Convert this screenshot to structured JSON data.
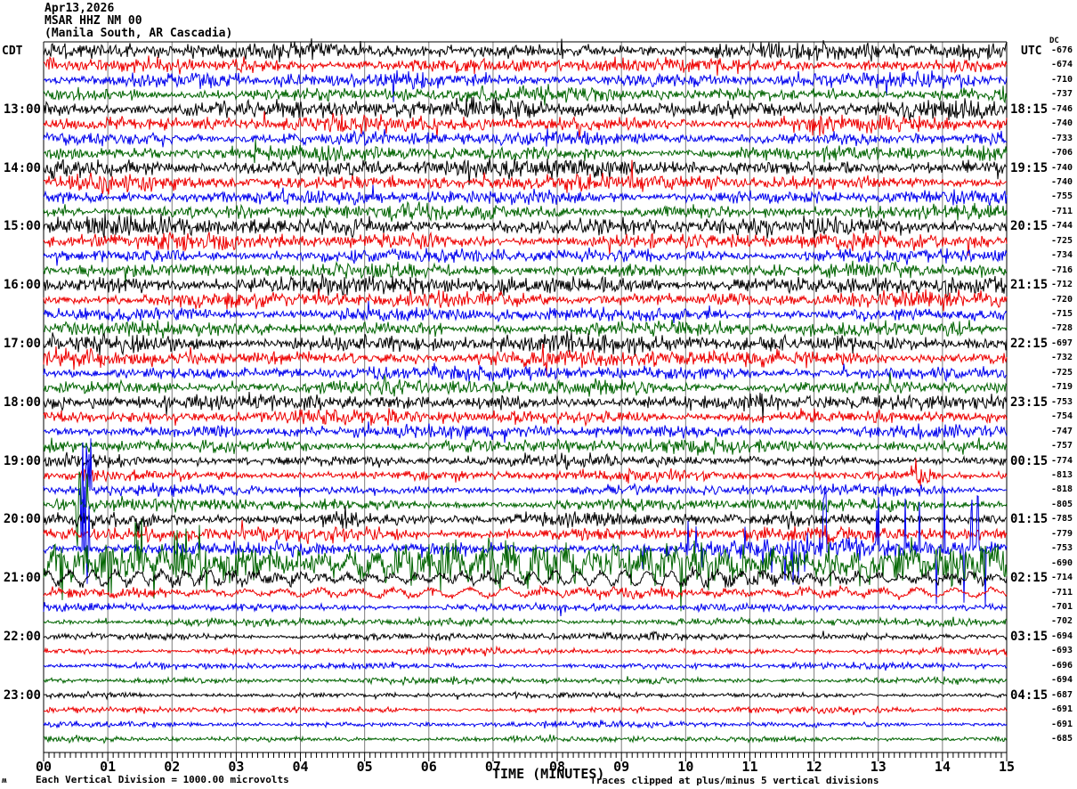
{
  "header": {
    "date": "Apr13,2026",
    "station_id": "MSAR HHZ NM 00",
    "station_name": "(Manila South, AR Cascadia)"
  },
  "timezones": {
    "left": "CDT",
    "right": "UTC"
  },
  "right_column_header": "DC",
  "x_axis": {
    "title": "TIME (MINUTES)",
    "tick_labels": [
      "00",
      "01",
      "02",
      "03",
      "04",
      "05",
      "06",
      "07",
      "08",
      "09",
      "10",
      "11",
      "12",
      "13",
      "14",
      "15"
    ]
  },
  "footer": {
    "scale_note": "Each Vertical Division = 1000.00 microvolts",
    "clip_note": "Traces clipped at plus/minus 5 vertical divisions",
    "corner_mark": "ʍ"
  },
  "left_hour_labels": [
    {
      "row": 4,
      "label": "13:00"
    },
    {
      "row": 8,
      "label": "14:00"
    },
    {
      "row": 12,
      "label": "15:00"
    },
    {
      "row": 16,
      "label": "16:00"
    },
    {
      "row": 20,
      "label": "17:00"
    },
    {
      "row": 24,
      "label": "18:00"
    },
    {
      "row": 28,
      "label": "19:00"
    },
    {
      "row": 32,
      "label": "20:00"
    },
    {
      "row": 36,
      "label": "21:00"
    },
    {
      "row": 40,
      "label": "22:00"
    },
    {
      "row": 44,
      "label": "23:00"
    }
  ],
  "right_utc_labels": [
    {
      "row": 4,
      "label": "18:15"
    },
    {
      "row": 8,
      "label": "19:15"
    },
    {
      "row": 12,
      "label": "20:15"
    },
    {
      "row": 16,
      "label": "21:15"
    },
    {
      "row": 20,
      "label": "22:15"
    },
    {
      "row": 24,
      "label": "23:15"
    },
    {
      "row": 28,
      "label": "00:15"
    },
    {
      "row": 32,
      "label": "01:15"
    },
    {
      "row": 36,
      "label": "02:15"
    },
    {
      "row": 40,
      "label": "03:15"
    },
    {
      "row": 44,
      "label": "04:15"
    }
  ],
  "colors": {
    "trace_cycle": [
      "#000000",
      "#ee0000",
      "#0000ee",
      "#006400"
    ],
    "grid": "#7d7d7d",
    "axis": "#000000",
    "background": "#ffffff"
  },
  "chart_data": {
    "type": "line",
    "subtype": "seismogram-helicorder",
    "rows": 48,
    "minutes_per_row": 15,
    "x_range_minutes": [
      0,
      15
    ],
    "clip_divisions": 5,
    "microvolts_per_division": 1000.0,
    "row_color_cycle": [
      "black",
      "red",
      "blue",
      "green"
    ],
    "dc_offsets": [
      -676,
      -674,
      -710,
      -737,
      -746,
      -740,
      -733,
      -706,
      -740,
      -740,
      -755,
      -711,
      -744,
      -725,
      -734,
      -716,
      -712,
      -720,
      -715,
      -728,
      -697,
      -732,
      -725,
      -719,
      -753,
      -754,
      -747,
      -757,
      -774,
      -813,
      -818,
      -805,
      -785,
      -779,
      -753,
      -690,
      -714,
      -711,
      -701,
      -702,
      -694,
      -693,
      -696,
      -694,
      -687,
      -691,
      -691,
      -685
    ],
    "row_params": [
      {
        "amp": 6.5,
        "events": [
          {
            "type": "spikes",
            "t0": 3.02,
            "t1": 3.1,
            "amp": 18,
            "density": 0.5
          },
          {
            "type": "spikes",
            "t0": 8.02,
            "t1": 8.1,
            "amp": 15,
            "density": 0.5
          }
        ]
      },
      {
        "amp": 6
      },
      {
        "amp": 5.5,
        "events": [
          {
            "type": "burst",
            "t0": 5.5,
            "t1": 6.3,
            "amp": 9
          }
        ]
      },
      {
        "amp": 5.5
      },
      {
        "amp": 7
      },
      {
        "amp": 6,
        "events": [
          {
            "type": "burst",
            "t0": 11.85,
            "t1": 12.25,
            "amp": 12
          }
        ]
      },
      {
        "amp": 5.5
      },
      {
        "amp": 5.5,
        "events": [
          {
            "type": "burst",
            "t0": 8.35,
            "t1": 8.75,
            "amp": 10
          }
        ]
      },
      {
        "amp": 7
      },
      {
        "amp": 6
      },
      {
        "amp": 5.5
      },
      {
        "amp": 5.5
      },
      {
        "amp": 7
      },
      {
        "amp": 6
      },
      {
        "amp": 5.5
      },
      {
        "amp": 5.5
      },
      {
        "amp": 7,
        "events": [
          {
            "type": "burst",
            "t0": 13.85,
            "t1": 14.35,
            "amp": 10
          }
        ]
      },
      {
        "amp": 6
      },
      {
        "amp": 5.5
      },
      {
        "amp": 5.5,
        "events": [
          {
            "type": "burst",
            "t0": 13.95,
            "t1": 14.45,
            "amp": 12
          }
        ]
      },
      {
        "amp": 7
      },
      {
        "amp": 6
      },
      {
        "amp": 5.5
      },
      {
        "amp": 5.5
      },
      {
        "amp": 6
      },
      {
        "amp": 5.5
      },
      {
        "amp": 5
      },
      {
        "amp": 5
      },
      {
        "amp": 4.5
      },
      {
        "amp": 4,
        "events": [
          {
            "type": "burst",
            "t0": 0.45,
            "t1": 0.9,
            "amp": 11
          },
          {
            "type": "burst",
            "t0": 13.4,
            "t1": 13.9,
            "amp": 22
          }
        ]
      },
      {
        "amp": 4,
        "events": [
          {
            "type": "spikes",
            "t0": 0.58,
            "t1": 0.75,
            "amp": 60,
            "density": 0.5
          }
        ]
      },
      {
        "amp": 4.5,
        "events": [
          {
            "type": "spikes",
            "t0": 0.5,
            "t1": 0.68,
            "amp": 55,
            "density": 0.5
          }
        ]
      },
      {
        "amp": 5,
        "events": [
          {
            "type": "burst",
            "t0": 4.15,
            "t1": 5.05,
            "amp": 11
          },
          {
            "type": "burst",
            "t0": 11.3,
            "t1": 11.9,
            "amp": 8
          }
        ]
      },
      {
        "amp": 5.5
      },
      {
        "amp": 5,
        "events": [
          {
            "type": "spikes",
            "t0": 0.6,
            "t1": 0.72,
            "amp": 70,
            "density": 0.5
          },
          {
            "type": "spikes",
            "t0": 9.2,
            "t1": 12.1,
            "amp": 32,
            "density": 0.06
          },
          {
            "type": "spikes",
            "t0": 12.1,
            "t1": 14.9,
            "amp": 72,
            "density": 0.09
          },
          {
            "type": "burst",
            "t0": 9.0,
            "t1": 15,
            "amp": 10
          }
        ]
      },
      {
        "amp": 16,
        "wave": {
          "amp": 10,
          "period": 30
        },
        "events": [
          {
            "type": "spikes",
            "t0": 0.1,
            "t1": 2.7,
            "amp": 48,
            "density": 0.09
          },
          {
            "type": "burst",
            "t0": 0.1,
            "t1": 2.7,
            "amp": 16
          },
          {
            "type": "spikes",
            "t0": 6.0,
            "t1": 8.0,
            "amp": 30,
            "density": 0.03
          },
          {
            "type": "spikes",
            "t0": 9.0,
            "t1": 14.9,
            "amp": 26,
            "density": 0.04
          }
        ]
      },
      {
        "amp": 4,
        "wave": {
          "amp": 7,
          "period": 26
        }
      },
      {
        "amp": 3.5,
        "wave": {
          "amp": 4,
          "period": 42
        }
      },
      {
        "amp": 3
      },
      {
        "amp": 3
      },
      {
        "amp": 2.8
      },
      {
        "amp": 2.5
      },
      {
        "amp": 2.5
      },
      {
        "amp": 2.5
      },
      {
        "amp": 2.2
      },
      {
        "amp": 2.2
      },
      {
        "amp": 2.2
      },
      {
        "amp": 2.2
      }
    ]
  }
}
